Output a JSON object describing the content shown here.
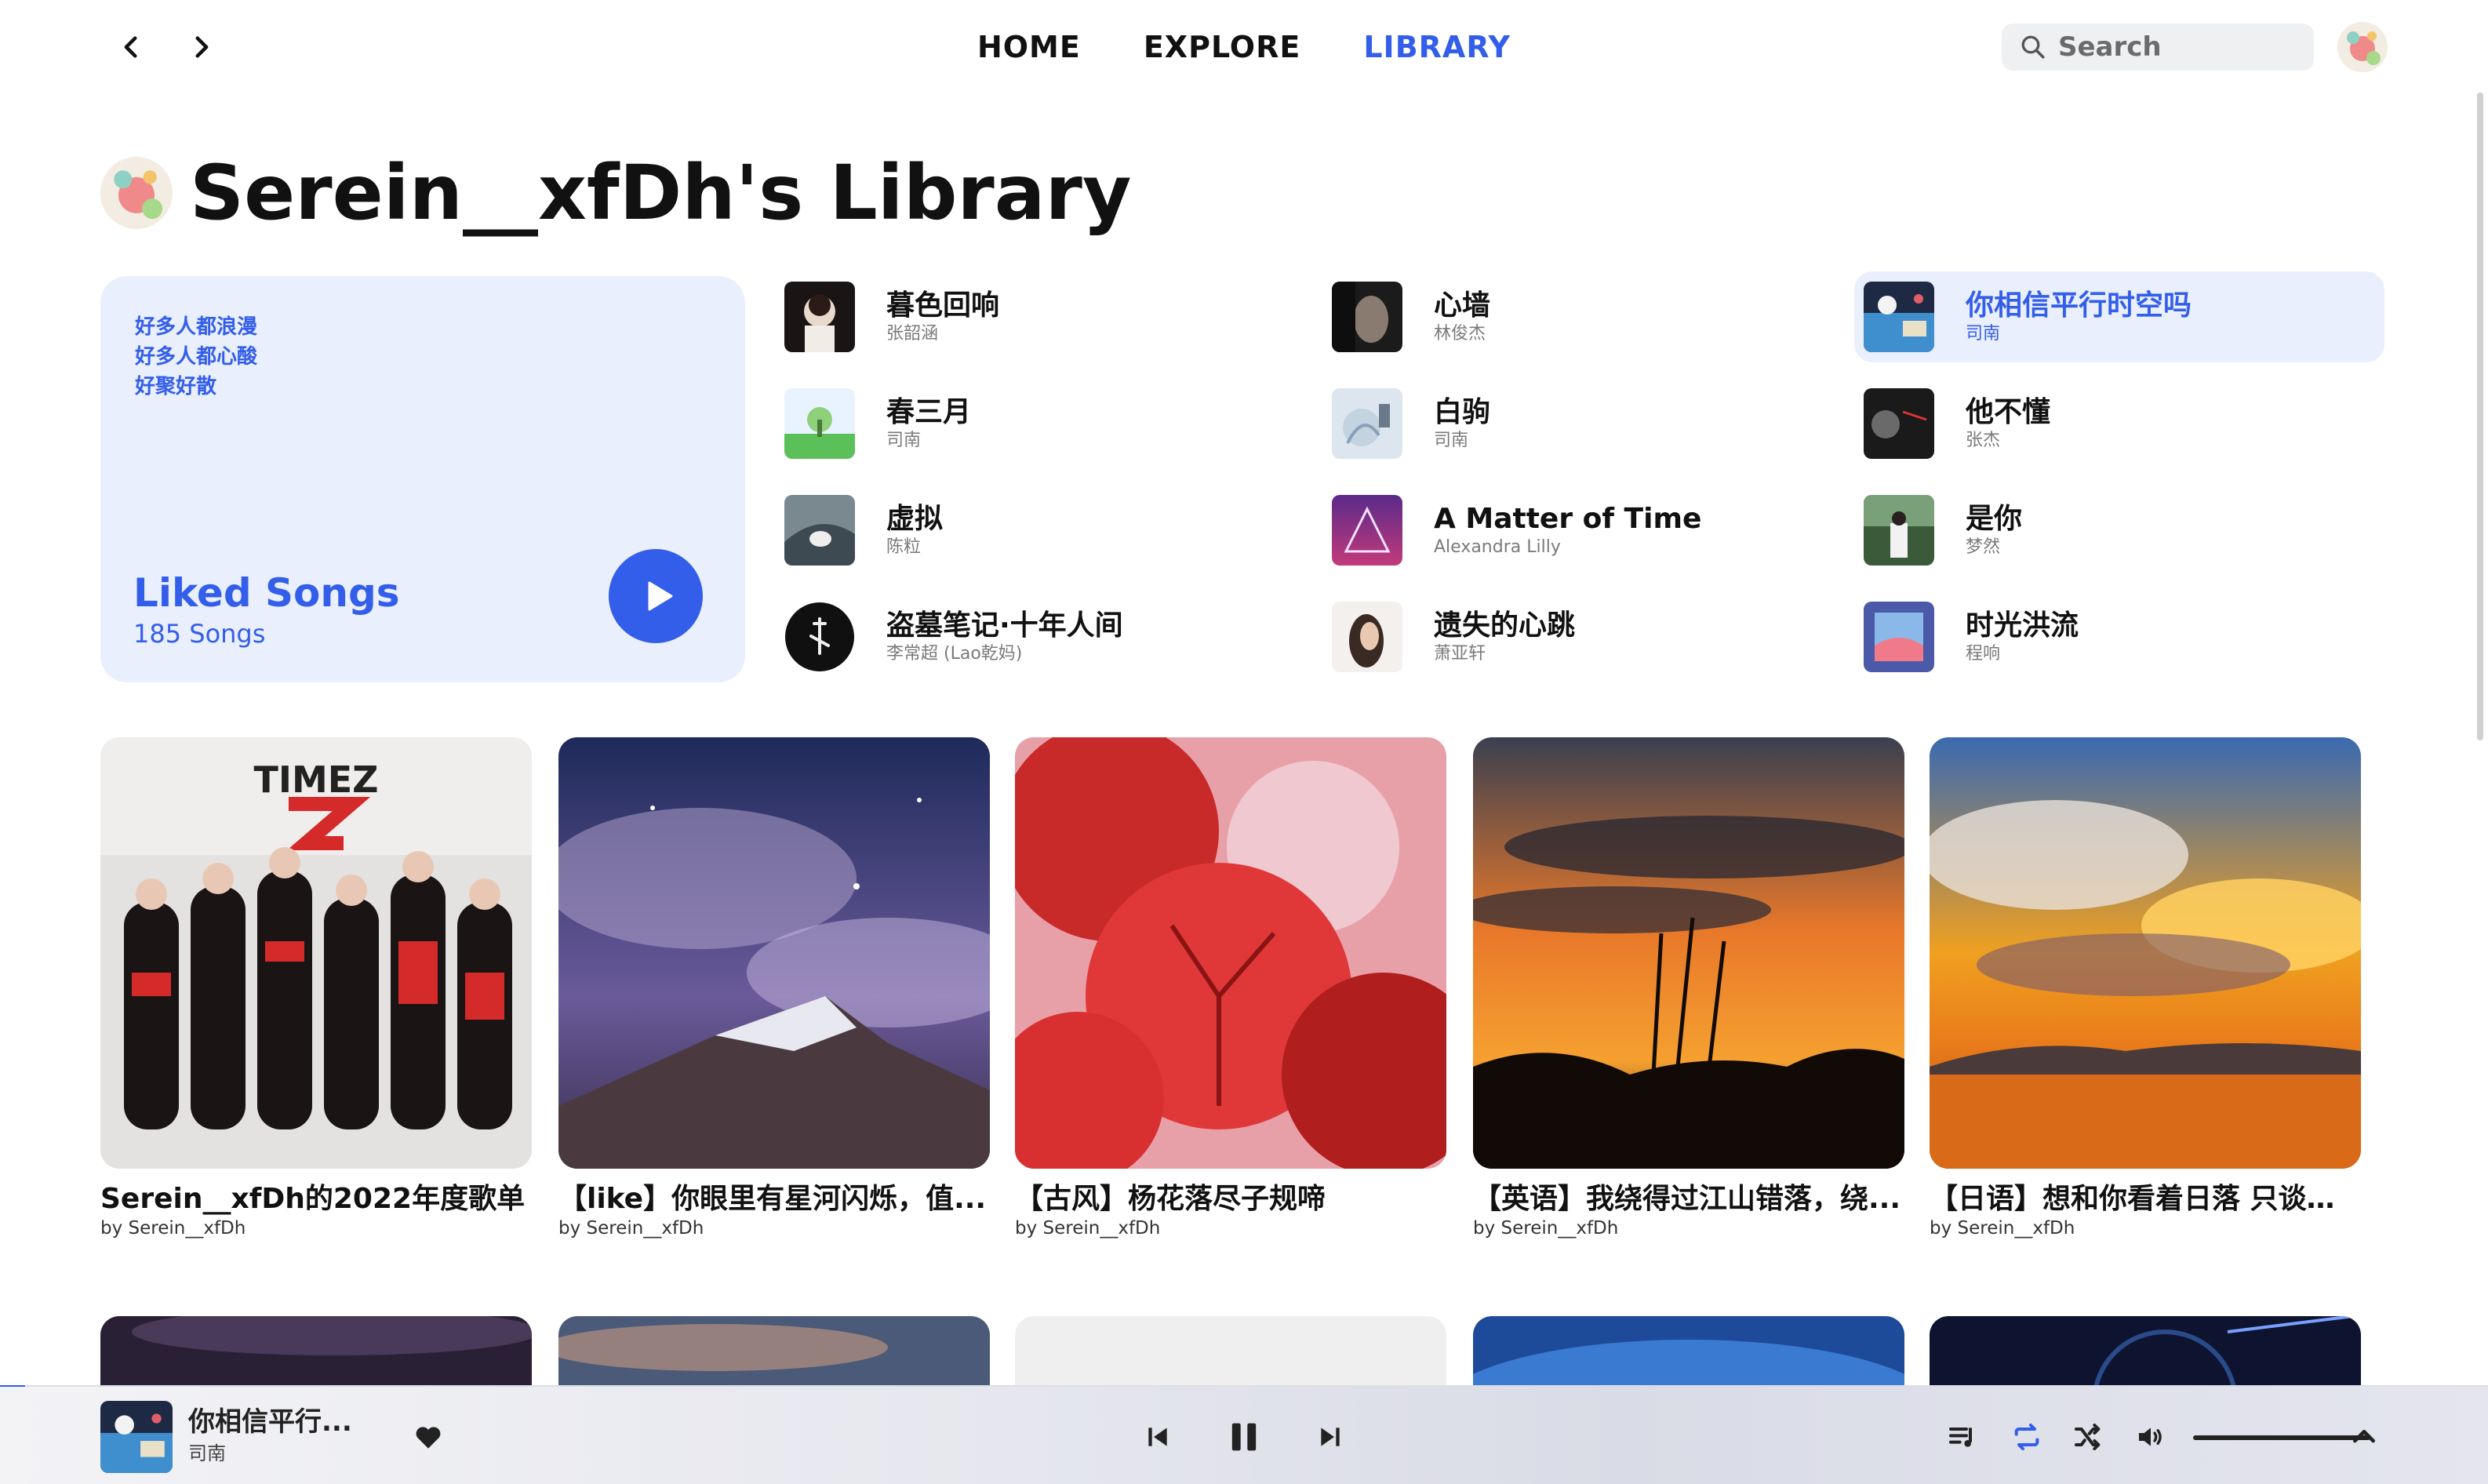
{
  "nav": {
    "links": [
      "HOME",
      "EXPLORE",
      "LIBRARY"
    ],
    "active": "LIBRARY",
    "search_placeholder": "Search"
  },
  "library": {
    "title": "Serein__xfDh's Library"
  },
  "liked": {
    "lyrics": [
      "好多人都浪漫",
      "好多人都心酸",
      "好聚好散"
    ],
    "title": "Liked Songs",
    "count": "185 Songs"
  },
  "tracks": [
    {
      "title": "暮色回响",
      "artist": "张韶涵"
    },
    {
      "title": "心墙",
      "artist": "林俊杰"
    },
    {
      "title": "你相信平行时空吗",
      "artist": "司南"
    },
    {
      "title": "春三月",
      "artist": "司南"
    },
    {
      "title": "白驹",
      "artist": "司南"
    },
    {
      "title": "他不懂",
      "artist": "张杰"
    },
    {
      "title": "虚拟",
      "artist": "陈粒"
    },
    {
      "title": "A Matter of Time",
      "artist": "Alexandra Lilly"
    },
    {
      "title": "是你",
      "artist": "梦然"
    },
    {
      "title": "盗墓笔记·十年人间",
      "artist": "李常超 (Lao乾妈)"
    },
    {
      "title": "遗失的心跳",
      "artist": "萧亚轩"
    },
    {
      "title": "时光洪流",
      "artist": "程响"
    }
  ],
  "active_track": "你相信平行时空吗",
  "playlists": [
    {
      "title": "Serein__xfDh的2022年度歌单",
      "by": "by Serein__xfDh"
    },
    {
      "title": "【like】你眼里有星河闪烁，值...",
      "by": "by Serein__xfDh"
    },
    {
      "title": "【古风】杨花落尽子规啼",
      "by": "by Serein__xfDh"
    },
    {
      "title": "【英语】我绕得过江山错落，绕...",
      "by": "by Serein__xfDh"
    },
    {
      "title": "【日语】想和你看着日落 只谈微...",
      "by": "by Serein__xfDh"
    }
  ],
  "player": {
    "title": "你相信平行...",
    "artist": "司南",
    "progress": 0.01,
    "volume": 1.0
  },
  "colors": {
    "accent": "#335eea",
    "accent_bg": "#eaeffd"
  },
  "icons": [
    "chevron-left-icon",
    "chevron-right-icon",
    "search-icon",
    "play-icon",
    "heart-icon",
    "skip-previous-icon",
    "pause-icon",
    "skip-next-icon",
    "playlist-icon",
    "repeat-icon",
    "shuffle-icon",
    "volume-icon",
    "chevron-up-icon"
  ]
}
